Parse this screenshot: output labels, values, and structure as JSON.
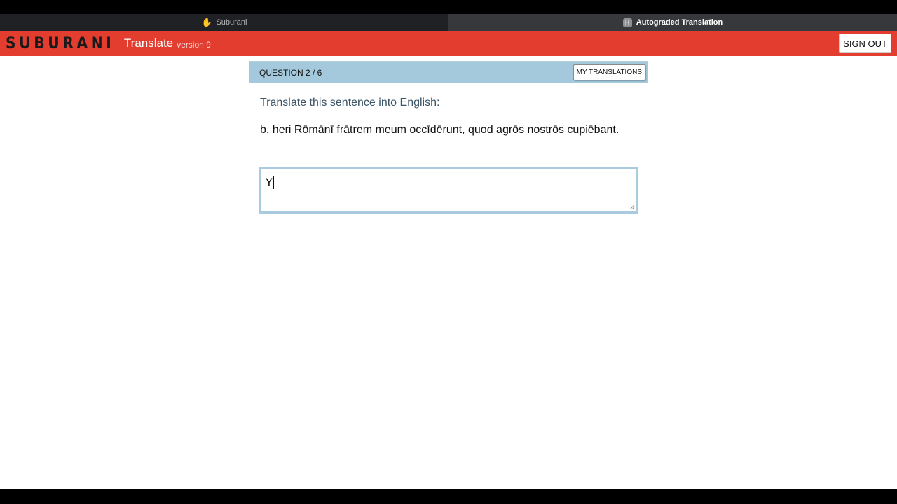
{
  "browser": {
    "tabs": [
      {
        "label": "Suburani",
        "icon": "hand-icon",
        "active": false
      },
      {
        "label": "Autograded Translation",
        "icon": "h-badge-icon",
        "badge": "H",
        "active": true
      }
    ]
  },
  "app": {
    "logo": "SUBURANI",
    "title": "Translate",
    "version": "version 9",
    "sign_out_label": "SIGN OUT",
    "brand_color": "#e23d2f"
  },
  "question": {
    "label": "QUESTION 2 / 6",
    "my_translations_label": "MY TRANSLATIONS",
    "instruction": "Translate this sentence into English:",
    "sentence": "b. heri Rōmānī frātrem meum occīdērunt, quod agrōs nostrōs cupiēbant.",
    "answer_value": "Y",
    "header_color": "#a4c8dc"
  }
}
